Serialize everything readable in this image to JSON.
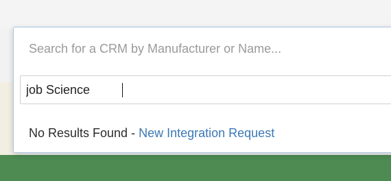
{
  "search": {
    "placeholder": "Search for a CRM by Manufacturer or Name...",
    "value": "job Science"
  },
  "results": {
    "message": "No Results Found - ",
    "link_label": "New Integration Request"
  },
  "colors": {
    "link": "#3b78b5",
    "placeholder": "#9a9a9a",
    "focus_border": "#a9c7e6",
    "background_green": "#4d8b53"
  }
}
